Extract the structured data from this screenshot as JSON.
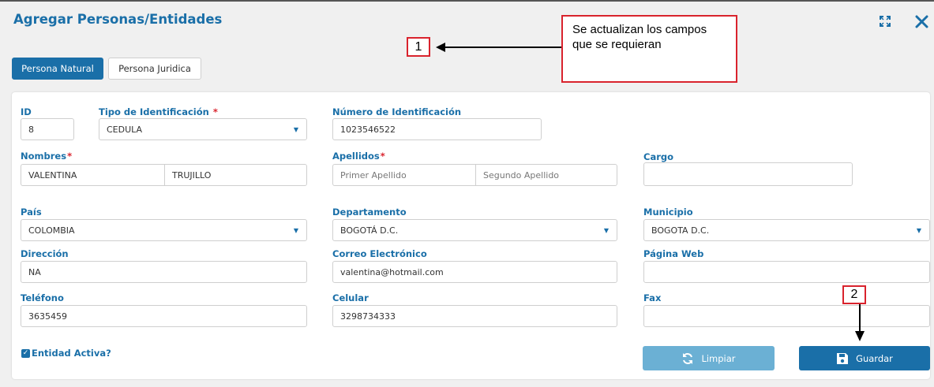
{
  "window": {
    "title": "Agregar Personas/Entidades",
    "expand_icon": "expand-icon",
    "close_icon": "close-icon"
  },
  "tabs": [
    {
      "label": "Persona Natural",
      "active": true
    },
    {
      "label": "Persona Juridica",
      "active": false
    }
  ],
  "form": {
    "id": {
      "label": "ID",
      "value": "8"
    },
    "tipo_id": {
      "label": "Tipo de Identificación",
      "required": "*",
      "value": "CEDULA"
    },
    "numero_id": {
      "label": "Número de Identificación",
      "value": "1023546522"
    },
    "nombres": {
      "label": "Nombres",
      "required": "*",
      "first": "VALENTINA",
      "second": "TRUJILLO"
    },
    "apellidos": {
      "label": "Apellidos",
      "required": "*",
      "first_placeholder": "Primer Apellido",
      "second_placeholder": "Segundo Apellido"
    },
    "cargo": {
      "label": "Cargo",
      "value": ""
    },
    "pais": {
      "label": "País",
      "value": "COLOMBIA"
    },
    "departamento": {
      "label": "Departamento",
      "value": "BOGOTÁ D.C."
    },
    "municipio": {
      "label": "Municipio",
      "value": "BOGOTA D.C."
    },
    "direccion": {
      "label": "Dirección",
      "value": "NA"
    },
    "correo": {
      "label": "Correo Electrónico",
      "value": "valentina@hotmail.com"
    },
    "pagina_web": {
      "label": "Página Web",
      "value": ""
    },
    "telefono": {
      "label": "Teléfono",
      "value": "3635459"
    },
    "celular": {
      "label": "Celular",
      "value": "3298734333"
    },
    "fax": {
      "label": "Fax",
      "value": ""
    },
    "entidad_activa": {
      "label": "Entidad Activa?",
      "checked": true
    }
  },
  "buttons": {
    "limpiar": {
      "label": "Limpiar",
      "icon": "refresh-icon",
      "color": "#6bb0d4"
    },
    "guardar": {
      "label": "Guardar",
      "icon": "floppy-disk-icon",
      "color": "#1a6fa8"
    }
  },
  "annotations": {
    "marker1": "1",
    "marker2": "2",
    "callout": "Se actualizan los campos que se requieran"
  },
  "colors": {
    "accent": "#1a6fa8",
    "required": "#d9232d",
    "annotation_red": "#d9232d"
  }
}
